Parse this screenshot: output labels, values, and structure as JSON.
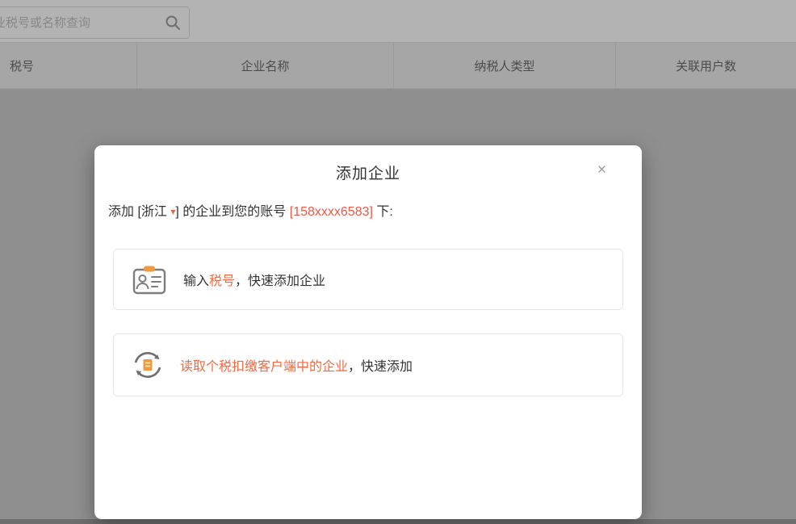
{
  "colors": {
    "accent_orange": "#f5683f",
    "phone_orange": "#f25744",
    "icon_clip_orange": "#ee9a3f",
    "overlay_gray": "#8f8f8f"
  },
  "topbar": {
    "search_placeholder": "企业税号或名称查询",
    "search_icon": "magnifier"
  },
  "table": {
    "headers": [
      "税号",
      "企业名称",
      "纳税人类型",
      "关联用户数"
    ]
  },
  "modal": {
    "title": "添加企业",
    "close_label": "×",
    "subtitle": {
      "p1": "添加 [",
      "region": "浙江",
      "caret": "▾",
      "p2": "] 的企业到您的账号 ",
      "phone": "[158xxxx6583]",
      "p3": " 下:"
    },
    "option1": {
      "icon": "id-card",
      "pre": "输入",
      "em": "税号",
      "post": "，快速添加企业"
    },
    "option2": {
      "icon": "sync-read",
      "em": "读取个税扣缴客户端中的企业",
      "post": "，快速添加"
    }
  }
}
